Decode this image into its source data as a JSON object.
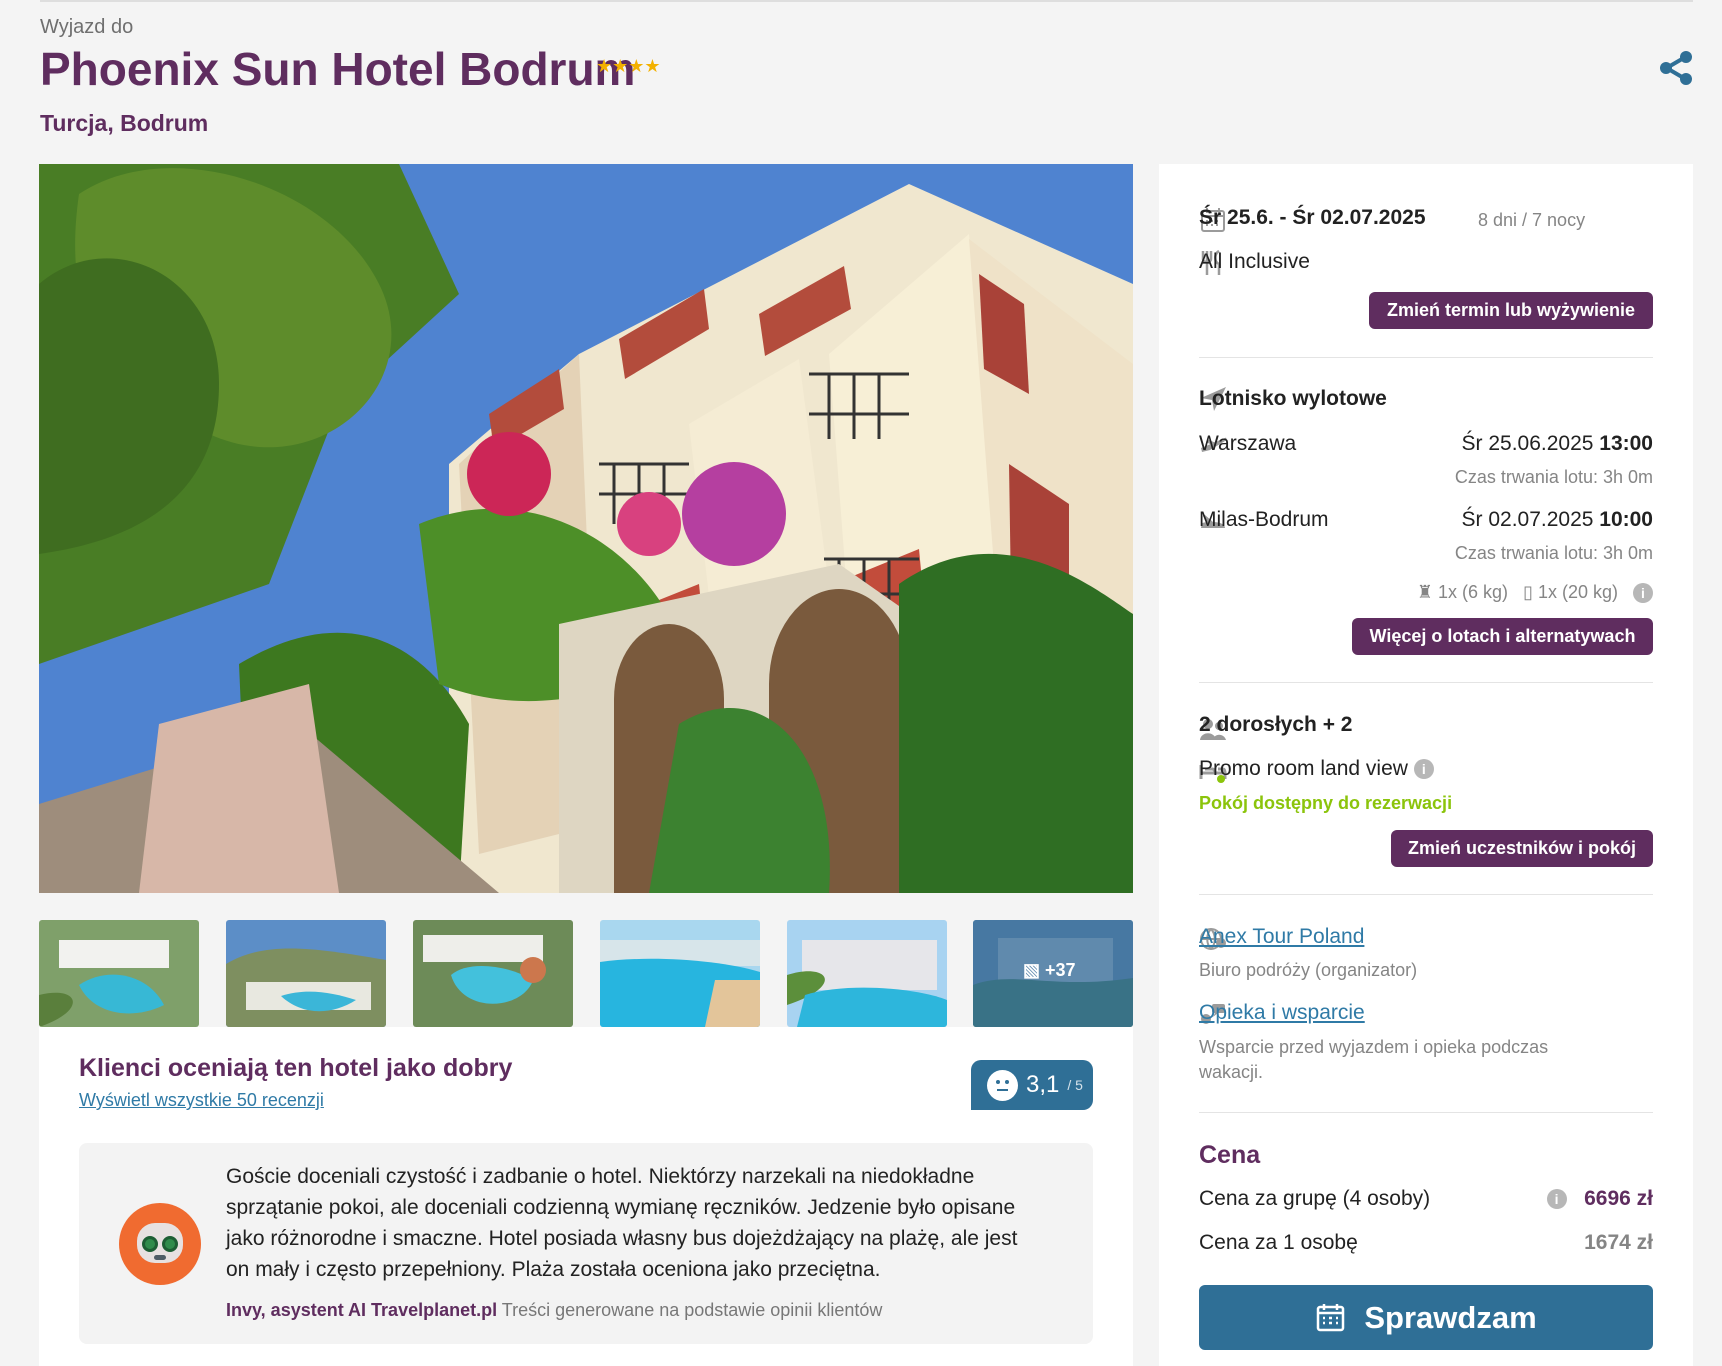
{
  "header": {
    "eyebrow": "Wyjazd do",
    "hotel_name": "Phoenix Sun Hotel Bodrum",
    "stars": "★★★★",
    "star_count": 4,
    "location": "Turcja, Bodrum",
    "share_icon": "share-icon"
  },
  "gallery": {
    "more_count": "+37",
    "image_icon": "image-icon"
  },
  "reviews": {
    "title": "Klienci oceniają ten hotel jako dobry",
    "link": "Wyświetl wszystkie 50 recenzji",
    "score": "3,1",
    "score_max": "/ 5",
    "summary": "Goście doceniali czystość i zadbanie o hotel. Niektórzy narzekali na niedokładne sprzątanie pokoi, ale doceniali codzienną wymianę ręczników. Jedzenie było opisane jako różnorodne i smaczne. Hotel posiada własny bus dojeżdżający na plażę, ale jest on mały i często przepełniony. Plaża została oceniona jako przeciętna.",
    "assistant": "Invy, asystent AI Travelplanet.pl",
    "assistant_note": "Treści generowane na podstawie opinii klientów"
  },
  "booking": {
    "date_range": "Śr 25.6. - Śr 02.07.2025",
    "duration": "8 dni / 7 nocy",
    "board": "All Inclusive",
    "change_board_button": "Zmień termin lub wyżywienie",
    "airport_label": "Lotnisko wylotowe",
    "departure_city": "Warszawa",
    "departure_date": "Śr 25.06.2025",
    "departure_time": "13:00",
    "departure_duration": "Czas trwania lotu: 3h 0m",
    "arrival_city": "Milas-Bodrum",
    "arrival_date": "Śr 02.07.2025",
    "arrival_time": "10:00",
    "arrival_duration": "Czas trwania lotu: 3h 0m",
    "hand_baggage": "1x (6 kg)",
    "checked_baggage": "1x (20 kg)",
    "flights_button": "Więcej o lotach i alternatywach",
    "participants": "2 dorosłych + 2",
    "room": "Promo room land view",
    "room_status": "Pokój dostępny do rezerwacji",
    "participants_button": "Zmień uczestników i pokój",
    "organizer_name": "Anex Tour Poland",
    "organizer_description": "Biuro podróży (organizator)",
    "support_link": "Opieka i wsparcie",
    "support_description": "Wsparcie przed wyjazdem i opieka podczas wakacji."
  },
  "price": {
    "label": "Cena",
    "group_label": "Cena za grupę (4 osoby)",
    "group_price": "6696 zł",
    "person_label": "Cena za 1 osobę",
    "person_price": "1674 zł",
    "check_button": "Sprawdzam"
  },
  "colors": {
    "brand": "#5f2d5f",
    "accent": "#2f6f96",
    "success": "#8bc40b",
    "background": "#f4f4f4"
  }
}
